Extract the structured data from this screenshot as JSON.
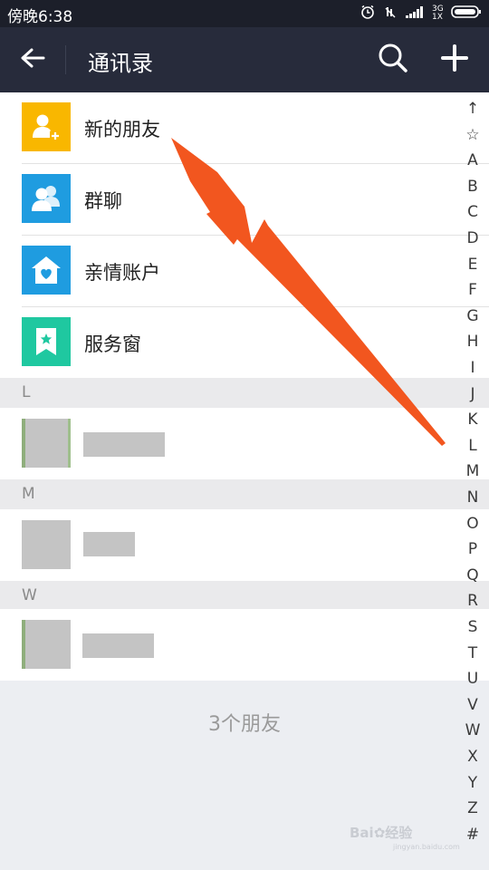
{
  "status_bar": {
    "time": "傍晚6:38",
    "network": "3G 1X",
    "icons": [
      "alarm-icon",
      "signal-slash-icon",
      "signal-bars-icon",
      "battery-icon"
    ]
  },
  "nav": {
    "title": "通讯录",
    "back_icon": "arrow-left-icon",
    "search_icon": "search-icon",
    "add_icon": "plus-icon"
  },
  "features": [
    {
      "label": "新的朋友",
      "icon": "add-friend-icon",
      "color": "#f9b700"
    },
    {
      "label": "群聊",
      "icon": "group-chat-icon",
      "color": "#1f9ce0"
    },
    {
      "label": "亲情账户",
      "icon": "family-home-icon",
      "color": "#1f9ce0"
    },
    {
      "label": "服务窗",
      "icon": "service-bookmark-icon",
      "color": "#1fc8a0"
    }
  ],
  "sections": [
    {
      "letter": "L"
    },
    {
      "letter": "M"
    },
    {
      "letter": "W"
    }
  ],
  "footer": {
    "count_text": "3个朋友"
  },
  "index": [
    "↑",
    "☆",
    "A",
    "B",
    "C",
    "D",
    "E",
    "F",
    "G",
    "H",
    "I",
    "J",
    "K",
    "L",
    "M",
    "N",
    "O",
    "P",
    "Q",
    "R",
    "S",
    "T",
    "U",
    "V",
    "W",
    "X",
    "Y",
    "Z",
    "#"
  ],
  "watermark": {
    "text": "Bai",
    "text2": "经验",
    "sub": "jingyan.baidu.com"
  },
  "colors": {
    "nav_bg": "#272b3b",
    "status_bg": "#1c1f2a",
    "arrow": "#f2561f"
  }
}
